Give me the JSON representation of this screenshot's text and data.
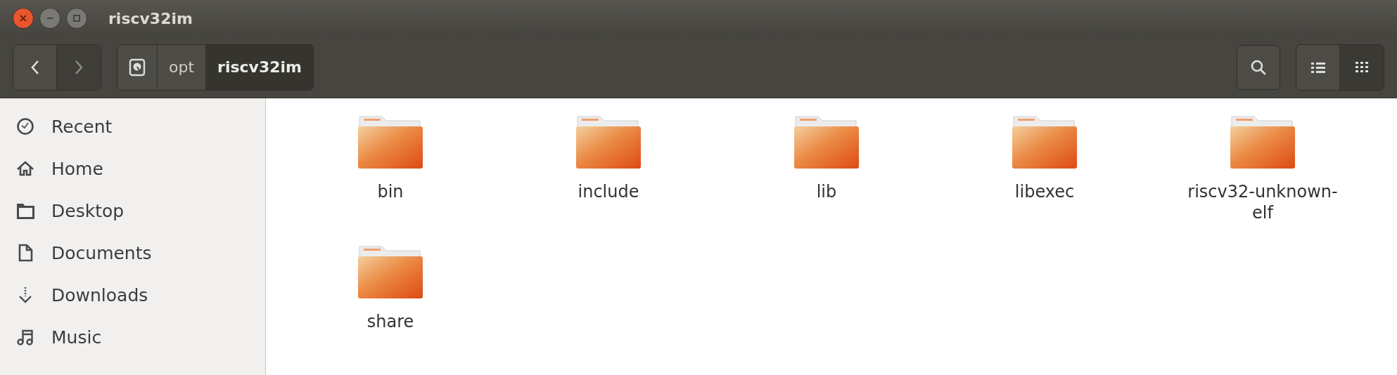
{
  "window": {
    "title": "riscv32im"
  },
  "toolbar": {
    "nav": [
      {
        "kind": "back",
        "disabled": false
      },
      {
        "kind": "forward",
        "disabled": true
      }
    ],
    "breadcrumbs": [
      {
        "kind": "drive",
        "selected": false
      },
      {
        "label": "opt",
        "selected": false
      },
      {
        "label": "riscv32im",
        "selected": true
      }
    ],
    "views": [
      {
        "kind": "list",
        "selected": false
      },
      {
        "kind": "grid",
        "selected": true
      }
    ]
  },
  "sidebar": {
    "items": [
      {
        "kind": "recent",
        "label": "Recent"
      },
      {
        "kind": "home",
        "label": "Home"
      },
      {
        "kind": "desktop",
        "label": "Desktop"
      },
      {
        "kind": "documents",
        "label": "Documents"
      },
      {
        "kind": "downloads",
        "label": "Downloads"
      },
      {
        "kind": "music",
        "label": "Music"
      }
    ]
  },
  "files": [
    {
      "name": "bin"
    },
    {
      "name": "include"
    },
    {
      "name": "lib"
    },
    {
      "name": "libexec"
    },
    {
      "name": "riscv32-unknown-elf"
    },
    {
      "name": "share"
    }
  ]
}
